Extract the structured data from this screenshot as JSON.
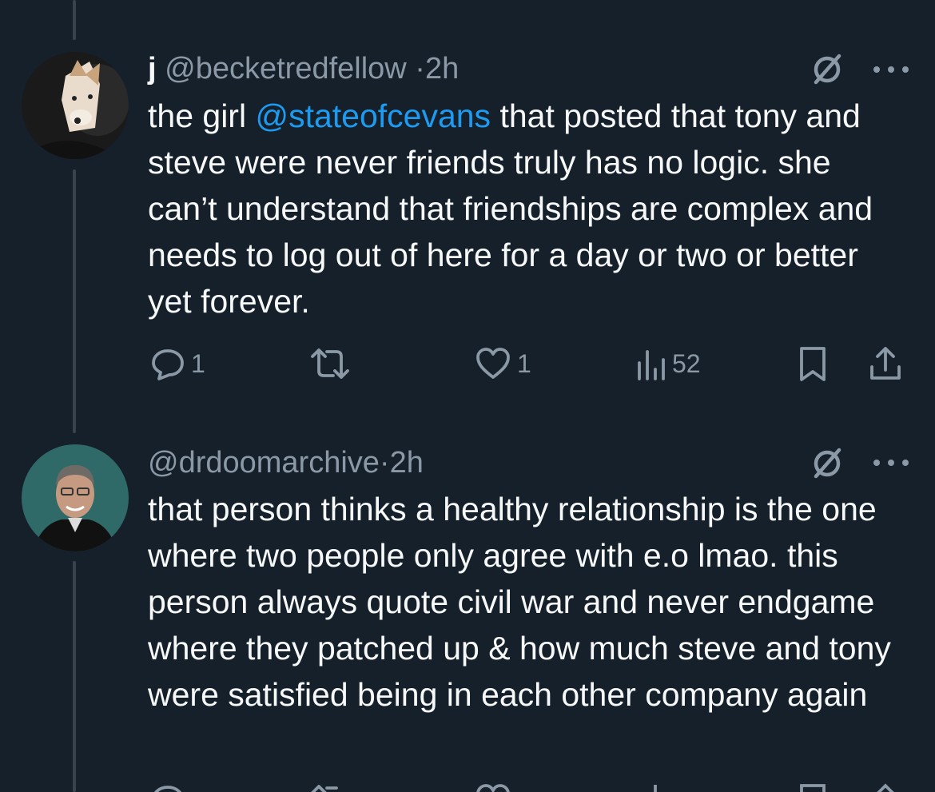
{
  "tweets": [
    {
      "name": "j",
      "handle": "@becketredfellow",
      "separator": "·",
      "time": "2h",
      "text_pre": "the girl ",
      "mention": "@stateofcevans",
      "text_post": " that posted that tony and steve were never friends truly has no logic. she can’t understand that friendships are complex and needs to log out of here for a day or two or better yet forever.",
      "avatar_icon": "dog-photo-avatar",
      "actions": {
        "replies": "1",
        "retweets": "",
        "likes": "1",
        "views": "52"
      }
    },
    {
      "name": "",
      "handle": "@drdoomarchive",
      "separator": "·",
      "time": "2h",
      "text": "that person thinks a healthy relationship is the one where two people only agree with e.o lmao. this person always quote civil war and never endgame where they patched up & how much steve and tony were satisfied being in each other company again",
      "avatar_icon": "man-portrait-avatar"
    }
  ],
  "icons": {
    "restricted": "restricted-icon",
    "more": "more-icon",
    "reply": "reply-icon",
    "retweet": "retweet-icon",
    "like": "heart-icon",
    "views": "views-icon",
    "bookmark": "bookmark-icon",
    "share": "share-icon"
  },
  "colors": {
    "background": "#15202b",
    "text": "#f7f9f9",
    "secondary": "#8b98a5",
    "accent": "#1d9bf0",
    "thread_line": "#38444d"
  }
}
